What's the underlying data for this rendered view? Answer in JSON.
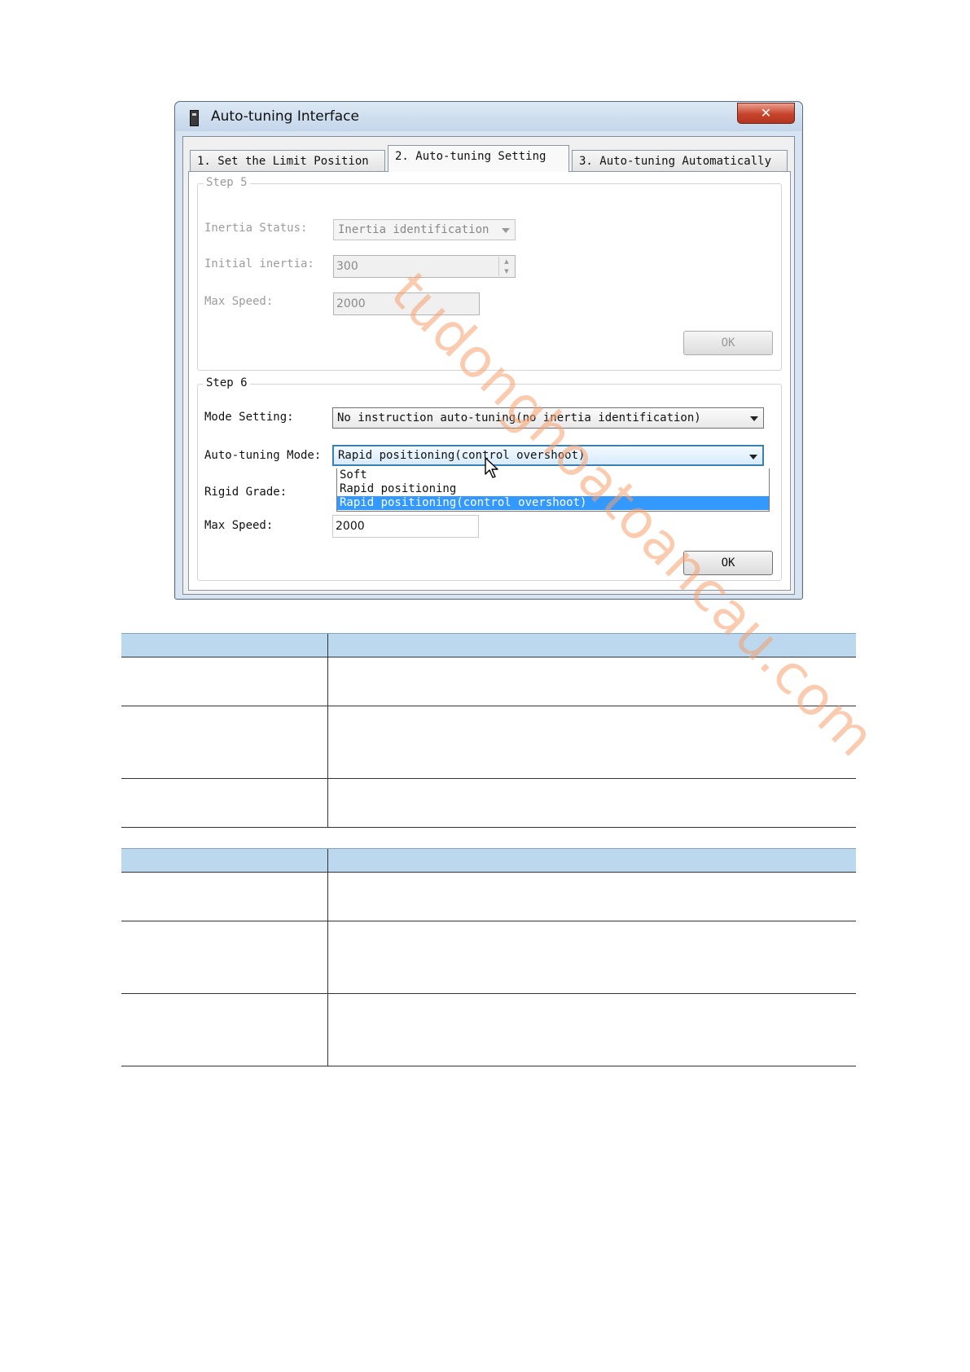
{
  "window": {
    "title": "Auto-tuning Interface",
    "close_label": "✕"
  },
  "tabs": [
    {
      "label": "1. Set the Limit Position"
    },
    {
      "label": "2. Auto-tuning Setting"
    },
    {
      "label": "3. Auto-tuning Automatically"
    }
  ],
  "step5": {
    "legend": "Step 5",
    "inertia_status_label": "Inertia Status:",
    "inertia_status_value": "Inertia identification",
    "initial_inertia_label": "Initial inertia:",
    "initial_inertia_value": "300",
    "max_speed_label": "Max Speed:",
    "max_speed_value": "2000",
    "ok_label": "OK"
  },
  "step6": {
    "legend": "Step 6",
    "mode_setting_label": "Mode Setting:",
    "mode_setting_value": "No instruction auto-tuning(no inertia identification)",
    "auto_tuning_mode_label": "Auto-tuning Mode:",
    "auto_tuning_mode_value": "Rapid positioning(control overshoot)",
    "auto_tuning_mode_options": [
      "Soft",
      "Rapid positioning",
      "Rapid positioning(control overshoot)"
    ],
    "rigid_grade_label": "Rigid Grade:",
    "max_speed_label": "Max Speed:",
    "max_speed_value": "2000",
    "ok_label": "OK"
  },
  "watermark": "tudonghoatoancau.com",
  "colors": {
    "table_header": "#bcd8ee",
    "dropdown_selected": "#3399ff",
    "close_button": "#c8432b"
  }
}
